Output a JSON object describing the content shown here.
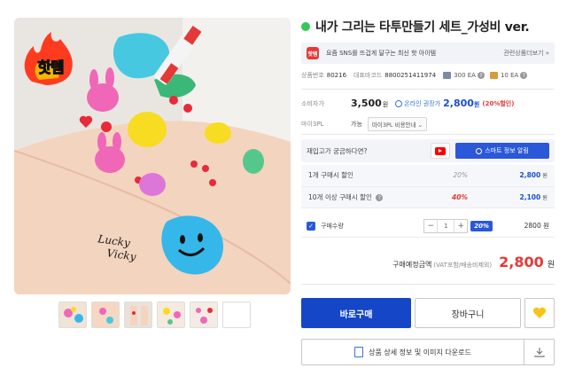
{
  "product": {
    "title": "내가 그리는 타투만들기 세트_가성비 ver.",
    "hot_badge": "핫템",
    "image_text": "Lucky Vicky"
  },
  "promo": {
    "icon_text": "핫템",
    "text": "요즘 SNS를 뜨겁게 달구는 최신 핫 아이템",
    "related_link": "관련상품더보기 »"
  },
  "meta": {
    "code_label": "상품번호",
    "code_value": "80216",
    "barcode_label": "대표바코드",
    "barcode_value": "8800251411974",
    "stock1": "300 EA",
    "stock2": "10 EA"
  },
  "price": {
    "consumer_label": "소비자가",
    "consumer_value": "3,500",
    "consumer_unit": "원",
    "online_label": "온라인 권장가",
    "online_value": "2,800",
    "online_unit": "원",
    "discount": "(20%할인)"
  },
  "pl3": {
    "label": "마이3PL",
    "available": "가능",
    "guide": "마이3PL 비용안내 ⌄"
  },
  "restock": {
    "question": "재입고가 궁금하다면?",
    "smart_button": "스마트 정보 알림"
  },
  "discounts": [
    {
      "name": "1개 구매시 할인",
      "rate": "20%",
      "price": "2,800",
      "unit": "원"
    },
    {
      "name": "10개 이상 구매시 할인",
      "rate": "40%",
      "price": "2,100",
      "unit": "원"
    }
  ],
  "quantity": {
    "label": "구매수량",
    "minus": "−",
    "value": "1",
    "plus": "+",
    "rate": "20%",
    "price": "2800 원"
  },
  "total": {
    "label": "구매예정금액",
    "sub": "(VAT포함/배송비제외)",
    "price": "2,800",
    "unit": "원"
  },
  "actions": {
    "buy": "바로구매",
    "cart": "장바구니",
    "detail": "상품 상세 정보 및 이미지 다운로드"
  },
  "colors": {
    "accent": "#1546c8",
    "sale": "#e53935",
    "status": "#34c759"
  }
}
